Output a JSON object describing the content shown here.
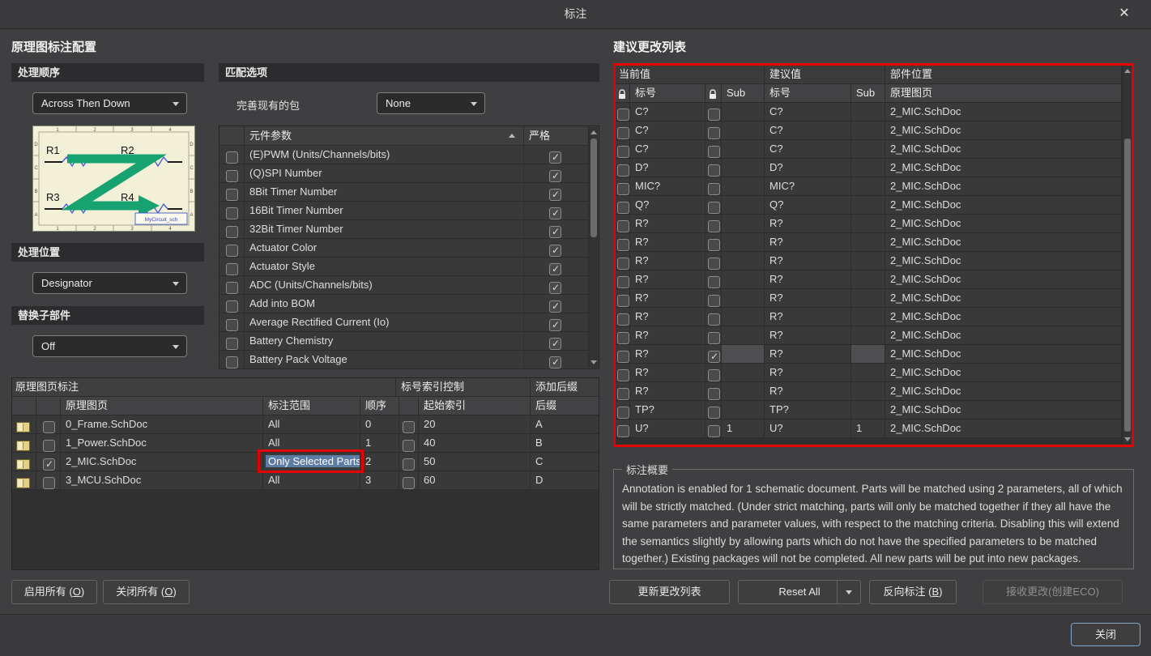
{
  "window": {
    "title": "标注",
    "close_glyph": "✕"
  },
  "colors": {
    "annotation_red": "#e80000",
    "selection_blue": "#5d7ca3",
    "preview_green": "#17a271",
    "preview_paper": "#f3f0d8"
  },
  "left": {
    "heading": "原理图标注配置",
    "order": {
      "header": "处理顺序",
      "value": "Across Then Down"
    },
    "preview": {
      "labels": [
        "R1",
        "R2",
        "R3",
        "R4"
      ],
      "watermark": "MyCircuit_sch",
      "ruler_cols": [
        "1",
        "2",
        "3",
        "4"
      ],
      "ruler_rows": [
        "D",
        "C",
        "B",
        "A"
      ]
    },
    "position": {
      "header": "处理位置",
      "value": "Designator"
    },
    "subparts": {
      "header": "替换子部件",
      "value": "Off"
    }
  },
  "match": {
    "header": "匹配选项",
    "complete_label": "完善现有的包",
    "complete_value": "None",
    "param_col": "元件参数",
    "strict_col": "严格",
    "params": [
      {
        "label": "(E)PWM (Units/Channels/bits)",
        "checked": false,
        "strict": true
      },
      {
        "label": "(Q)SPI Number",
        "checked": false,
        "strict": true
      },
      {
        "label": "8Bit Timer Number",
        "checked": false,
        "strict": true
      },
      {
        "label": "16Bit Timer Number",
        "checked": false,
        "strict": true
      },
      {
        "label": "32Bit Timer Number",
        "checked": false,
        "strict": true
      },
      {
        "label": "Actuator Color",
        "checked": false,
        "strict": true
      },
      {
        "label": "Actuator Style",
        "checked": false,
        "strict": true
      },
      {
        "label": "ADC (Units/Channels/bits)",
        "checked": false,
        "strict": true
      },
      {
        "label": "Add into BOM",
        "checked": false,
        "strict": true
      },
      {
        "label": "Average Rectified Current (Io)",
        "checked": false,
        "strict": true
      },
      {
        "label": "Battery Chemistry",
        "checked": false,
        "strict": true
      },
      {
        "label": "Battery Pack Voltage",
        "checked": false,
        "strict": true
      }
    ]
  },
  "sheets": {
    "group_headers": [
      "原理图页标注",
      "标号索引控制",
      "添加后缀"
    ],
    "col_sheet": "原理图页",
    "col_scope": "标注范围",
    "col_order": "顺序",
    "col_index": "起始索引",
    "col_suffix": "后缀",
    "rows": [
      {
        "name": "0_Frame.SchDoc",
        "enabled": false,
        "scope": "All",
        "order": "0",
        "index_checked": false,
        "index": "20",
        "suffix": "A",
        "highlight": false
      },
      {
        "name": "1_Power.SchDoc",
        "enabled": false,
        "scope": "All",
        "order": "1",
        "index_checked": false,
        "index": "40",
        "suffix": "B",
        "highlight": false
      },
      {
        "name": "2_MIC.SchDoc",
        "enabled": true,
        "scope": "Only Selected Parts",
        "order": "2",
        "index_checked": false,
        "index": "50",
        "suffix": "C",
        "highlight": true
      },
      {
        "name": "3_MCU.SchDoc",
        "enabled": false,
        "scope": "All",
        "order": "3",
        "index_checked": false,
        "index": "60",
        "suffix": "D",
        "highlight": false
      }
    ],
    "enable_all": {
      "prefix": "启用所有 (",
      "key": "O",
      "suffix": ")"
    },
    "disable_all": {
      "prefix": "关闭所有 (",
      "key": "O",
      "suffix": ")"
    }
  },
  "proposed": {
    "heading": "建议更改列表",
    "group_current": "当前值",
    "group_proposed": "建议值",
    "group_location": "部件位置",
    "col_designator": "标号",
    "col_sub": "Sub",
    "col_sheet": "原理图页",
    "rows": [
      {
        "current": "C?",
        "current_sub": "",
        "proposed": "C?",
        "proposed_sub": "",
        "sheet": "2_MIC.SchDoc",
        "checked": false,
        "sub_checked": false,
        "sub_highlight": false
      },
      {
        "current": "C?",
        "current_sub": "",
        "proposed": "C?",
        "proposed_sub": "",
        "sheet": "2_MIC.SchDoc",
        "checked": false,
        "sub_checked": false,
        "sub_highlight": false
      },
      {
        "current": "C?",
        "current_sub": "",
        "proposed": "C?",
        "proposed_sub": "",
        "sheet": "2_MIC.SchDoc",
        "checked": false,
        "sub_checked": false,
        "sub_highlight": false
      },
      {
        "current": "D?",
        "current_sub": "",
        "proposed": "D?",
        "proposed_sub": "",
        "sheet": "2_MIC.SchDoc",
        "checked": false,
        "sub_checked": false,
        "sub_highlight": false
      },
      {
        "current": "MIC?",
        "current_sub": "",
        "proposed": "MIC?",
        "proposed_sub": "",
        "sheet": "2_MIC.SchDoc",
        "checked": false,
        "sub_checked": false,
        "sub_highlight": false
      },
      {
        "current": "Q?",
        "current_sub": "",
        "proposed": "Q?",
        "proposed_sub": "",
        "sheet": "2_MIC.SchDoc",
        "checked": false,
        "sub_checked": false,
        "sub_highlight": false
      },
      {
        "current": "R?",
        "current_sub": "",
        "proposed": "R?",
        "proposed_sub": "",
        "sheet": "2_MIC.SchDoc",
        "checked": false,
        "sub_checked": false,
        "sub_highlight": false
      },
      {
        "current": "R?",
        "current_sub": "",
        "proposed": "R?",
        "proposed_sub": "",
        "sheet": "2_MIC.SchDoc",
        "checked": false,
        "sub_checked": false,
        "sub_highlight": false
      },
      {
        "current": "R?",
        "current_sub": "",
        "proposed": "R?",
        "proposed_sub": "",
        "sheet": "2_MIC.SchDoc",
        "checked": false,
        "sub_checked": false,
        "sub_highlight": false
      },
      {
        "current": "R?",
        "current_sub": "",
        "proposed": "R?",
        "proposed_sub": "",
        "sheet": "2_MIC.SchDoc",
        "checked": false,
        "sub_checked": false,
        "sub_highlight": false
      },
      {
        "current": "R?",
        "current_sub": "",
        "proposed": "R?",
        "proposed_sub": "",
        "sheet": "2_MIC.SchDoc",
        "checked": false,
        "sub_checked": false,
        "sub_highlight": false
      },
      {
        "current": "R?",
        "current_sub": "",
        "proposed": "R?",
        "proposed_sub": "",
        "sheet": "2_MIC.SchDoc",
        "checked": false,
        "sub_checked": false,
        "sub_highlight": false
      },
      {
        "current": "R?",
        "current_sub": "",
        "proposed": "R?",
        "proposed_sub": "",
        "sheet": "2_MIC.SchDoc",
        "checked": false,
        "sub_checked": false,
        "sub_highlight": false
      },
      {
        "current": "R?",
        "current_sub": "",
        "proposed": "R?",
        "proposed_sub": "",
        "sheet": "2_MIC.SchDoc",
        "checked": false,
        "sub_checked": true,
        "sub_highlight": true
      },
      {
        "current": "R?",
        "current_sub": "",
        "proposed": "R?",
        "proposed_sub": "",
        "sheet": "2_MIC.SchDoc",
        "checked": false,
        "sub_checked": false,
        "sub_highlight": false
      },
      {
        "current": "R?",
        "current_sub": "",
        "proposed": "R?",
        "proposed_sub": "",
        "sheet": "2_MIC.SchDoc",
        "checked": false,
        "sub_checked": false,
        "sub_highlight": false
      },
      {
        "current": "TP?",
        "current_sub": "",
        "proposed": "TP?",
        "proposed_sub": "",
        "sheet": "2_MIC.SchDoc",
        "checked": false,
        "sub_checked": false,
        "sub_highlight": false
      },
      {
        "current": "U?",
        "current_sub": "1",
        "proposed": "U?",
        "proposed_sub": "1",
        "sheet": "2_MIC.SchDoc",
        "checked": false,
        "sub_checked": false,
        "sub_highlight": false
      }
    ],
    "summary_header": "标注概要",
    "summary_text": "Annotation is enabled for 1 schematic document. Parts will be matched using 2 parameters, all of which will be strictly matched. (Under strict matching, parts will only be matched together if they all have the same parameters and parameter values, with respect to the matching criteria. Disabling this will extend the semantics slightly by allowing parts which do not have the specified parameters to be matched together.) Existing packages will not be completed. All new parts will be put into new packages.",
    "update_btn": "更新更改列表",
    "reset_btn": "Reset All",
    "back_btn": {
      "prefix": "反向标注 (",
      "key": "B",
      "suffix": ")"
    },
    "accept_btn": "接收更改(创建ECO)"
  },
  "footer": {
    "close_btn": "关闭"
  }
}
